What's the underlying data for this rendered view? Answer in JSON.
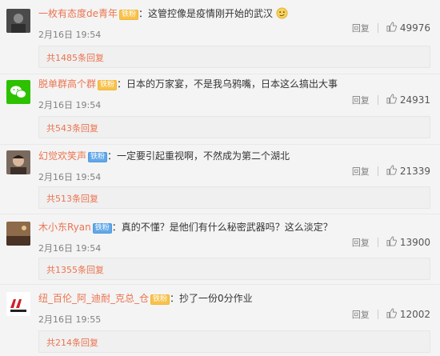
{
  "comments": [
    {
      "username": "一枚有态度de青年",
      "badges": [
        {
          "text": "铁粉",
          "style": "vip"
        }
      ],
      "separator": "：",
      "text": "这管控像是疫情刚开始的武汉",
      "emoji": "smirk-emoji",
      "date": "2月16日 19:54",
      "reply_label": "回复",
      "likes": "49976",
      "replies_label": "共1485条回复"
    },
    {
      "username": "脱单群高个群",
      "badges": [
        {
          "text": "铁粉",
          "style": "vip"
        }
      ],
      "separator": "：",
      "text": "日本的万家宴，不是我乌鸦嘴，日本这么搞出大事",
      "emoji": "",
      "date": "2月16日 19:54",
      "reply_label": "回复",
      "likes": "24931",
      "replies_label": "共543条回复"
    },
    {
      "username": "幻觉欢笑声",
      "badges": [
        {
          "text": "铁粉",
          "style": "blue"
        }
      ],
      "separator": "：",
      "text": "一定要引起重视啊，不然成为第二个湖北",
      "emoji": "",
      "date": "2月16日 19:54",
      "reply_label": "回复",
      "likes": "21339",
      "replies_label": "共513条回复"
    },
    {
      "username": "木小东Ryan",
      "badges": [
        {
          "text": "铁粉",
          "style": "blue"
        }
      ],
      "separator": "：",
      "text": "真的不懂？是他们有什么秘密武器吗？这么淡定？",
      "emoji": "",
      "date": "2月16日 19:54",
      "reply_label": "回复",
      "likes": "13900",
      "replies_label": "共1355条回复"
    },
    {
      "username": "纽_百伦_阿_迪耐_克总_仓",
      "badges": [
        {
          "text": "铁粉",
          "style": "vip"
        }
      ],
      "separator": "：",
      "text": "抄了一份0分作业",
      "emoji": "",
      "date": "2月16日 19:55",
      "reply_label": "回复",
      "likes": "12002",
      "replies_label": "共214条回复"
    }
  ],
  "colors": {
    "username": "#eb7350",
    "text": "#333333",
    "meta": "#808080",
    "background": "#f4f4f4"
  }
}
